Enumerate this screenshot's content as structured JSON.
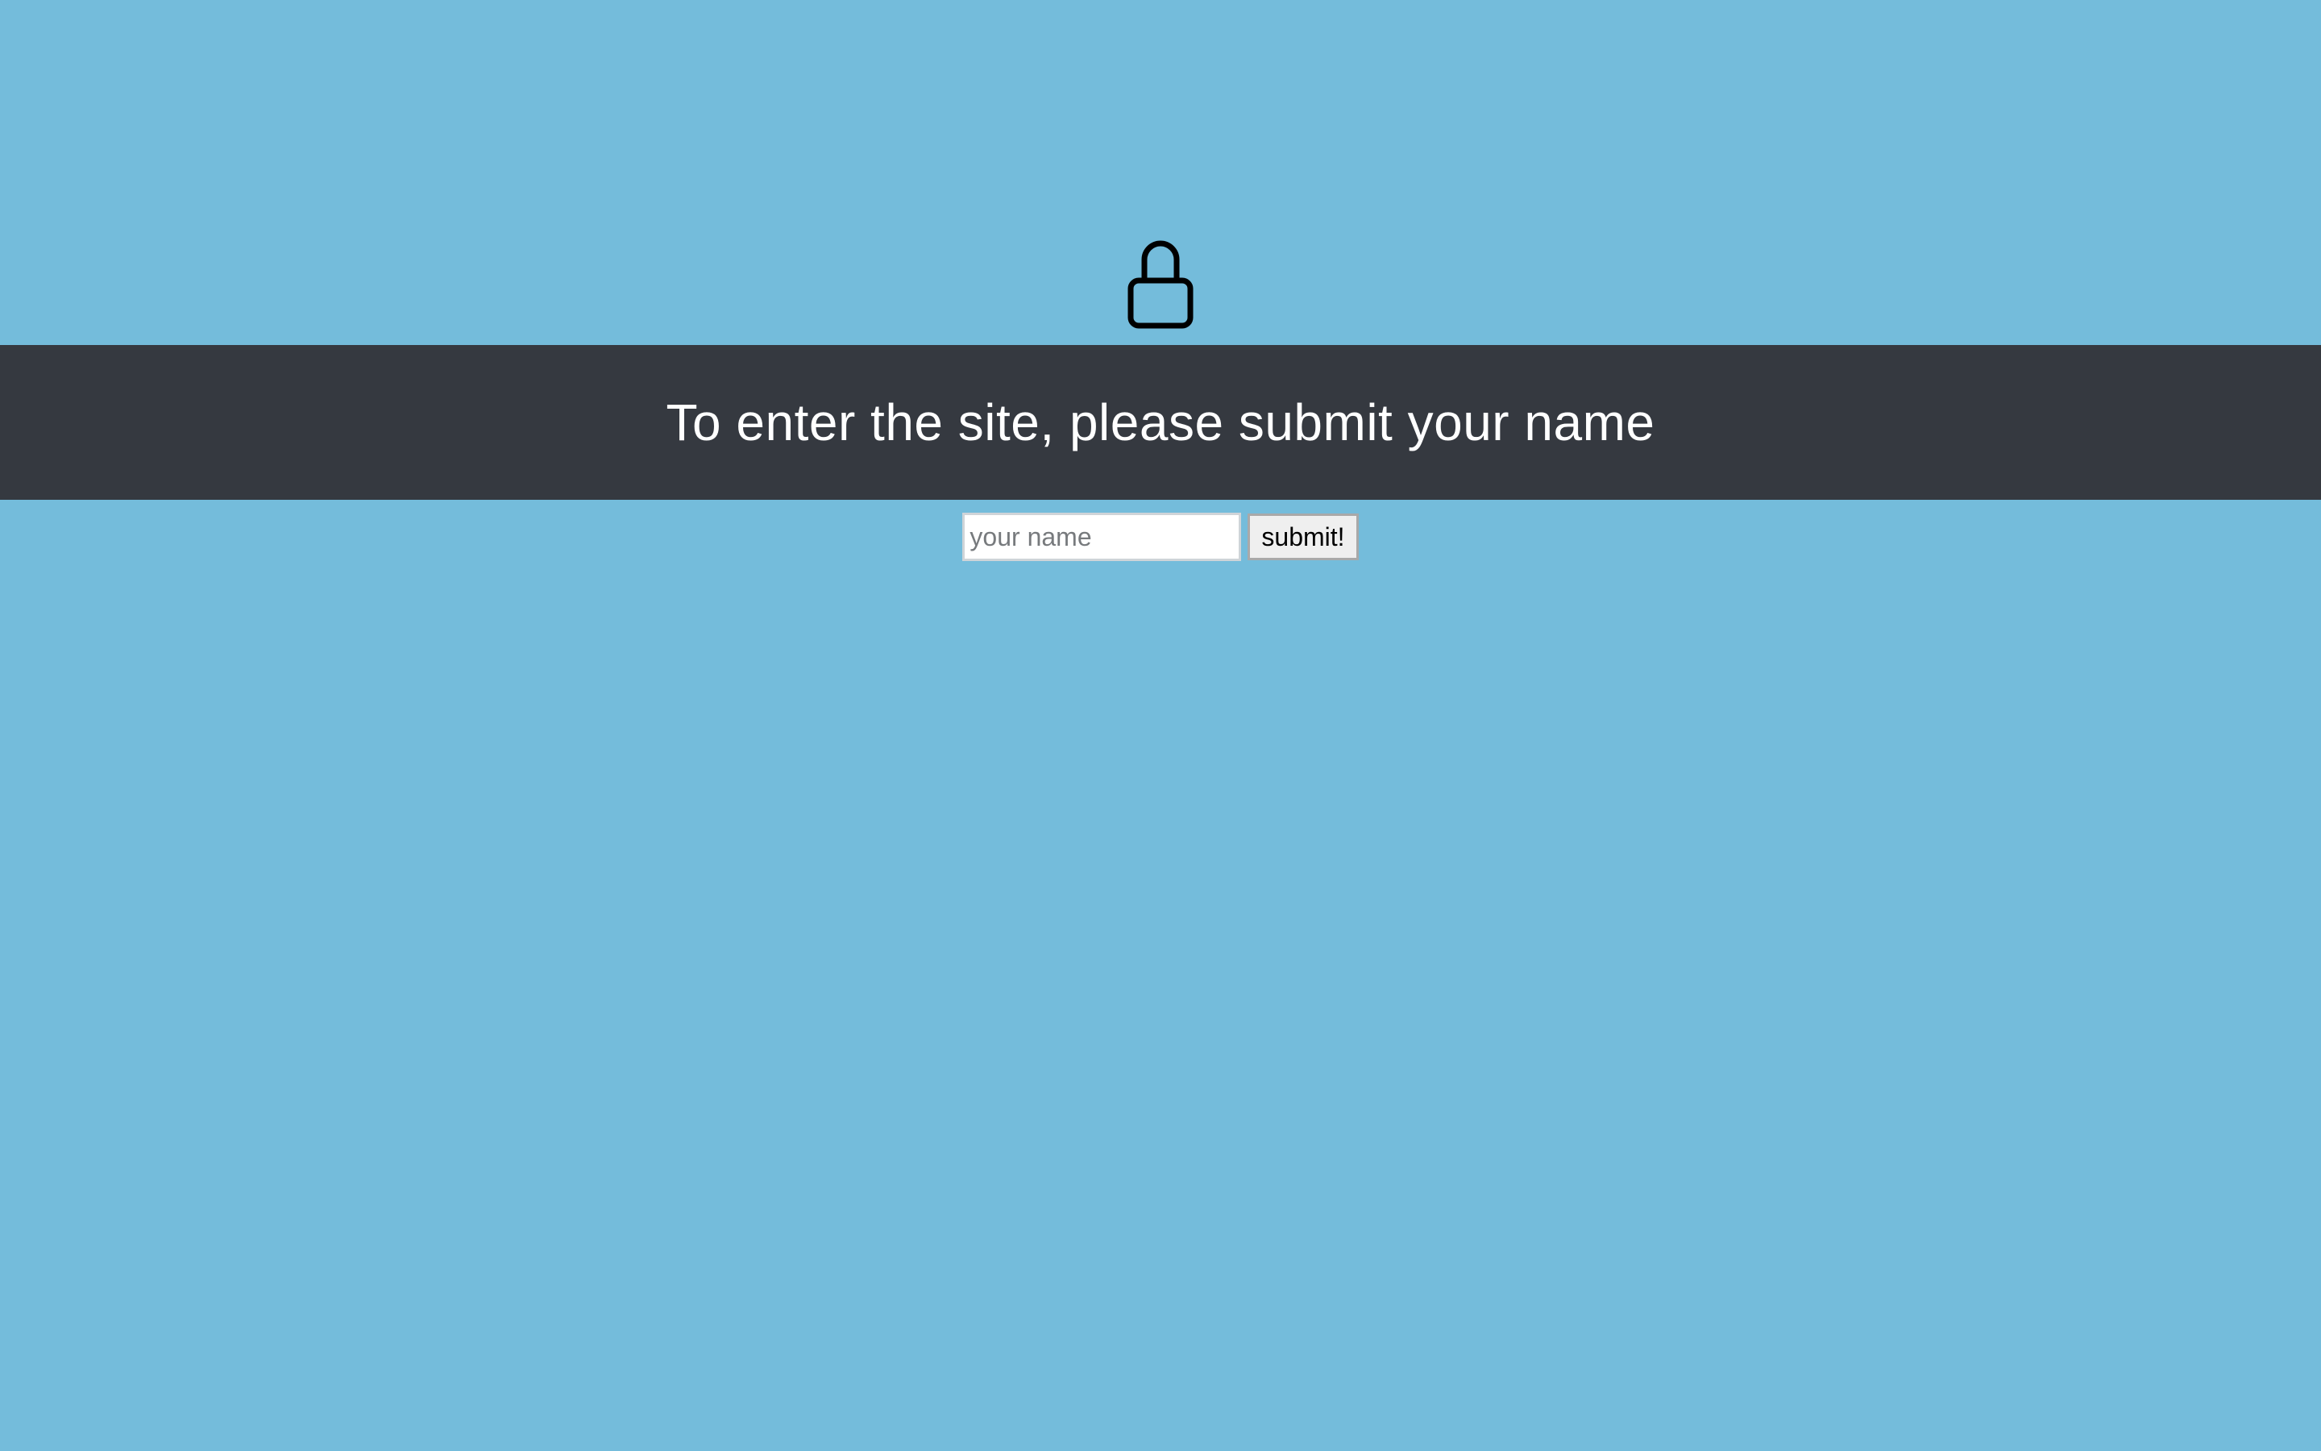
{
  "page": {
    "background_color": "#74bcdb"
  },
  "lock": {
    "icon": "lock-icon"
  },
  "banner": {
    "heading": "To enter the site, please submit your name",
    "background_color": "#353940",
    "text_color": "#ffffff"
  },
  "form": {
    "name_input": {
      "placeholder": "your name",
      "value": ""
    },
    "submit_label": "submit!"
  }
}
